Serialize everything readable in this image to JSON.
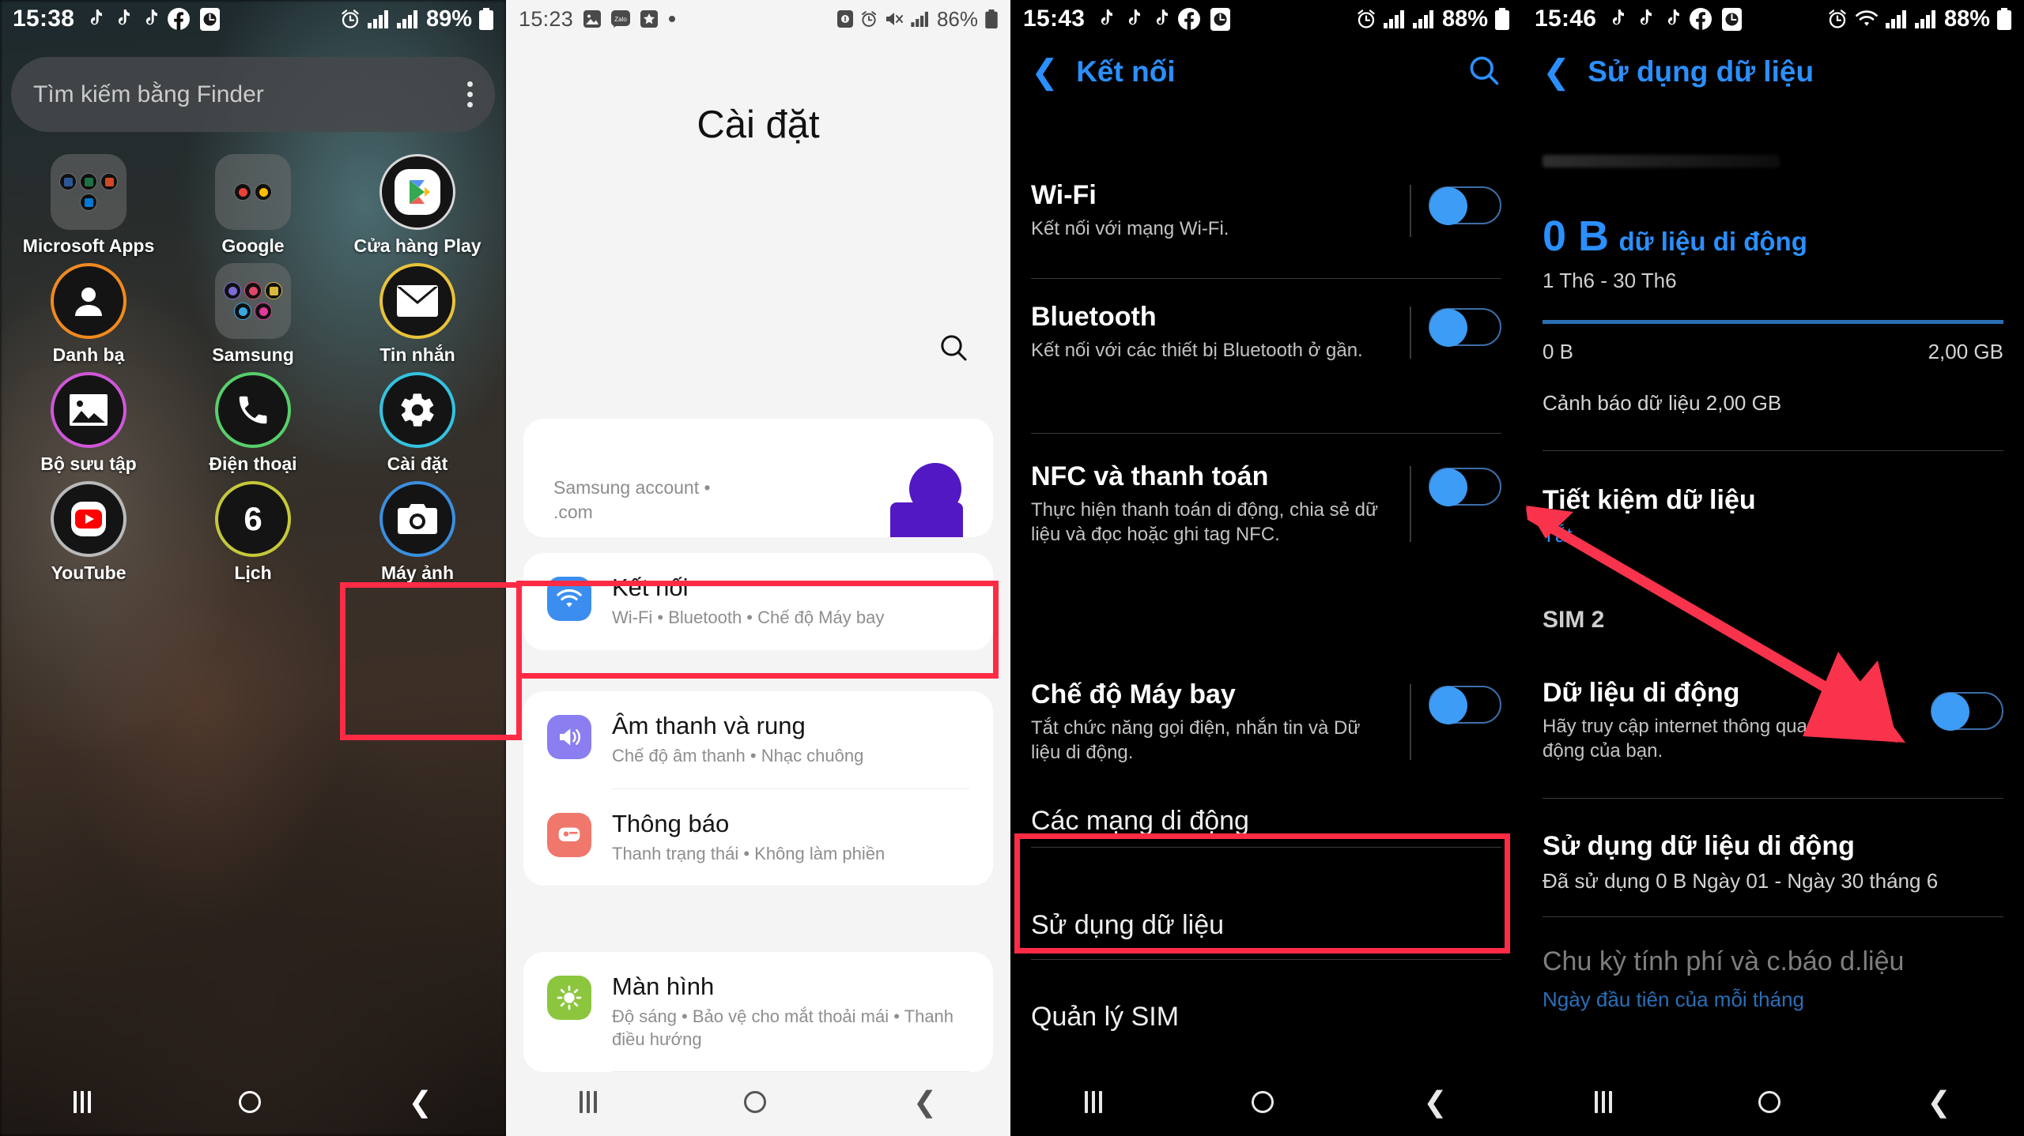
{
  "panel1": {
    "status": {
      "time": "15:38",
      "battery": "89%",
      "left_icons": [
        "tiktok-icon",
        "tiktok-icon",
        "tiktok-icon",
        "facebook-icon",
        "clock-icon"
      ],
      "right_icons": [
        "alarm-icon",
        "signal-sim1-icon",
        "signal-sim2-icon",
        "battery-icon"
      ]
    },
    "search": {
      "placeholder": "Tìm kiếm bằng Finder",
      "menu": "more-options-icon"
    },
    "apps": [
      {
        "label": "Microsoft Apps",
        "kind": "folder",
        "ring": ""
      },
      {
        "label": "Google",
        "kind": "folder",
        "ring": ""
      },
      {
        "label": "Cửa hàng Play",
        "kind": "play",
        "ring": "#d8d8d8"
      },
      {
        "label": "Danh bạ",
        "kind": "contacts",
        "ring": "#f08a1e"
      },
      {
        "label": "Samsung",
        "kind": "folder",
        "ring": ""
      },
      {
        "label": "Tin nhắn",
        "kind": "messages",
        "ring": "#e8c33a"
      },
      {
        "label": "Bộ sưu tập",
        "kind": "gallery",
        "ring": "#cf57d8"
      },
      {
        "label": "Điện thoại",
        "kind": "phone",
        "ring": "#57cf6b"
      },
      {
        "label": "Cài đặt",
        "kind": "settings",
        "ring": "#34c3e0"
      },
      {
        "label": "YouTube",
        "kind": "youtube",
        "ring": "#b9b9b9"
      },
      {
        "label": "Lịch",
        "kind": "calendar",
        "ring": "#c5c93a",
        "badge": "6"
      },
      {
        "label": "Máy ảnh",
        "kind": "camera",
        "ring": "#3a8fe0"
      }
    ],
    "nav": [
      "recents-icon",
      "home-icon",
      "back-icon"
    ]
  },
  "panel2": {
    "status": {
      "time": "15:23",
      "battery": "86%",
      "left_icons": [
        "photo-icon",
        "zalo-icon",
        "star-icon",
        "dot-icon"
      ],
      "right_icons": [
        "camera-upload-icon",
        "alarm-icon",
        "mute-icon",
        "signal-icon",
        "battery-icon"
      ]
    },
    "title": "Cài đặt",
    "search_icon": "search-icon",
    "account": {
      "line1": "Samsung account  •",
      "line2": ".com",
      "avatar": "avatar-icon"
    },
    "items": [
      {
        "title": "Kết nối",
        "sub": "Wi-Fi  •  Bluetooth  •  Chế độ Máy bay",
        "icon": "wifi-icon",
        "color": "#3b8ef0",
        "highlighted": true
      },
      {
        "title": "Âm thanh và rung",
        "sub": "Chế độ âm thanh  •  Nhạc chuông",
        "icon": "sound-icon",
        "color": "#8a7ef0",
        "highlighted": false
      },
      {
        "title": "Thông báo",
        "sub": "Thanh trạng thái  •  Không làm phiền",
        "icon": "notification-icon",
        "color": "#f0776b",
        "highlighted": false
      },
      {
        "title": "Màn hình",
        "sub": "Độ sáng  •  Bảo vệ cho mắt thoải mái  •  Thanh điều hướng",
        "icon": "brightness-icon",
        "color": "#8cc63f",
        "highlighted": false
      }
    ],
    "nav": [
      "recents-icon",
      "home-icon",
      "back-icon"
    ]
  },
  "panel3": {
    "status": {
      "time": "15:43",
      "battery": "88%",
      "left_icons": [
        "tiktok-icon",
        "tiktok-icon",
        "tiktok-icon",
        "facebook-icon",
        "clock-icon"
      ],
      "right_icons": [
        "alarm-icon",
        "signal-sim1-icon",
        "signal-sim2-icon",
        "battery-icon"
      ]
    },
    "header": {
      "back": "back-arrow-icon",
      "title": "Kết nối",
      "search": "search-icon"
    },
    "toggles": [
      {
        "title": "Wi-Fi",
        "sub": "Kết nối với mạng Wi-Fi.",
        "on": true
      },
      {
        "title": "Bluetooth",
        "sub": "Kết nối với các thiết bị Bluetooth ở gần.",
        "on": true
      },
      {
        "title": "NFC và thanh toán",
        "sub": "Thực hiện thanh toán di động, chia sẻ dữ liệu và đọc hoặc ghi tag NFC.",
        "on": true
      },
      {
        "title": "Chế độ Máy bay",
        "sub": "Tắt chức năng gọi điện, nhắn tin và Dữ liệu di động.",
        "on": true
      }
    ],
    "rows": [
      {
        "title": "Các mạng di động",
        "highlighted": false
      },
      {
        "title": "Sử dụng dữ liệu",
        "highlighted": true
      },
      {
        "title": "Quản lý SIM",
        "highlighted": false
      }
    ],
    "nav": [
      "recents-icon",
      "home-icon",
      "back-icon"
    ]
  },
  "panel4": {
    "status": {
      "time": "15:46",
      "battery": "88%",
      "left_icons": [
        "tiktok-icon",
        "tiktok-icon",
        "tiktok-icon",
        "facebook-icon",
        "clock-icon"
      ],
      "right_icons": [
        "alarm-icon",
        "wifi-icon",
        "signal-sim1-icon",
        "signal-sim2-icon",
        "battery-icon"
      ]
    },
    "header": {
      "back": "back-arrow-icon",
      "title": "Sử dụng dữ liệu"
    },
    "usage": {
      "amount": "0 B",
      "label": "dữ liệu di động",
      "range": "1 Th6 - 30 Th6",
      "bar_start": "0 B",
      "bar_end": "2,00 GB",
      "warning": "Cảnh báo dữ liệu 2,00 GB"
    },
    "data_saver": {
      "title": "Tiết kiệm dữ liệu",
      "value": "Tắt"
    },
    "sim_label": "SIM 2",
    "mobile_data": {
      "title": "Dữ liệu di động",
      "sub": "Hãy truy cập internet thông qua mạng di động của bạn.",
      "on": true
    },
    "mobile_usage": {
      "title": "Sử dụng dữ liệu di động",
      "sub": "Đã sử dụng 0 B Ngày 01 - Ngày 30 tháng 6"
    },
    "billing": {
      "title": "Chu kỳ tính phí và c.báo d.liệu",
      "sub": "Ngày đầu tiên của mỗi tháng"
    },
    "nav": [
      "recents-icon",
      "home-icon",
      "back-icon"
    ]
  },
  "annotations": {
    "accent_red": "#ff2b45",
    "boxes": [
      "settings-app-highlight",
      "connections-row-highlight",
      "data-usage-row-highlight"
    ],
    "arrow": "mobile-data-toggle-arrow"
  }
}
